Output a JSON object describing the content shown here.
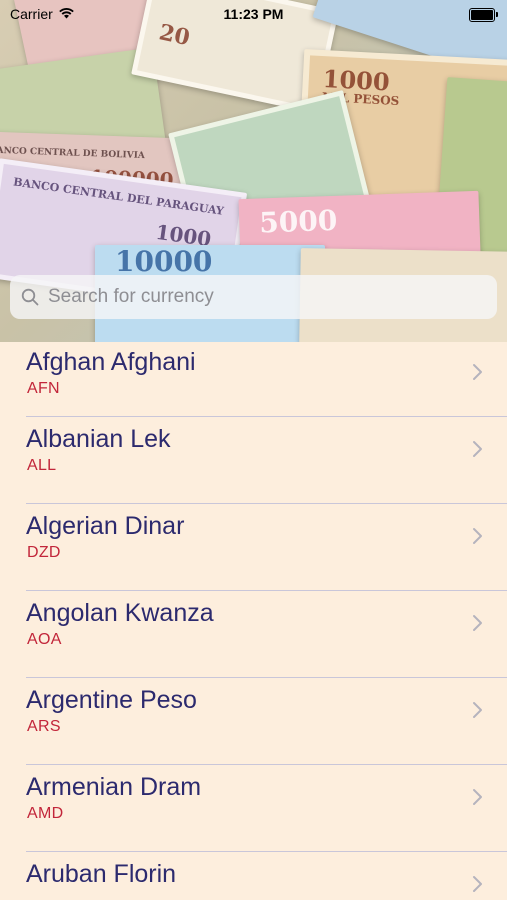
{
  "status_bar": {
    "carrier": "Carrier",
    "time": "11:23 PM"
  },
  "search": {
    "placeholder": "Search for currency",
    "value": ""
  },
  "hero_banknote_labels": [
    "20",
    "1000",
    "MIL PESOS",
    "BANCO CENTRAL DEL PARAGUAY",
    "100000",
    "1000",
    "5000",
    "10000",
    "BANCO CENTRAL DE BOLIVIA"
  ],
  "currencies": [
    {
      "name": "Afghan Afghani",
      "code": "AFN"
    },
    {
      "name": "Albanian Lek",
      "code": "ALL"
    },
    {
      "name": "Algerian Dinar",
      "code": "DZD"
    },
    {
      "name": "Angolan Kwanza",
      "code": "AOA"
    },
    {
      "name": "Argentine Peso",
      "code": "ARS"
    },
    {
      "name": "Armenian Dram",
      "code": "AMD"
    },
    {
      "name": "Aruban Florin",
      "code": ""
    }
  ],
  "colors": {
    "background": "#fdeedd",
    "name_text": "#2c2a6e",
    "code_text": "#c2263a",
    "separator": "#c9c6d9"
  }
}
